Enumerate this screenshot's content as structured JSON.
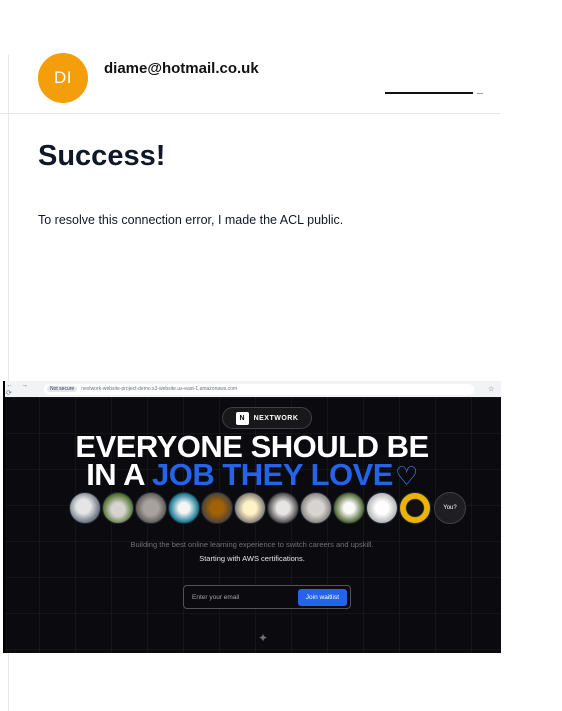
{
  "header": {
    "avatar_initials": "DI",
    "avatar_color": "#f59e0b",
    "email": "diame@hotmail.co.uk"
  },
  "main": {
    "title": "Success!",
    "message": "To resolve this connection error, I made the ACL public."
  },
  "screenshot": {
    "browser": {
      "nav_icons": "← → ⟳",
      "secure_label": "Not secure",
      "url": "nextwork-website-project-demo.s3-website.us-east-1.amazonaws.com",
      "star_icon": "star-icon"
    },
    "brand": {
      "logo_text": "N",
      "name": "NEXTWORK"
    },
    "headline_line1": "EVERYONE SHOULD BE",
    "headline_line2_prefix": "IN A ",
    "headline_line2_highlight": "JOB THEY LOVE",
    "heart": "♡",
    "you_label": "You?",
    "tagline": "Building the best online learning experience to switch careers and upskill.",
    "subtagline": "Starting with AWS certifications.",
    "email_placeholder": "Enter your email",
    "join_button": "Join waitlist",
    "accent_color": "#2563eb"
  }
}
